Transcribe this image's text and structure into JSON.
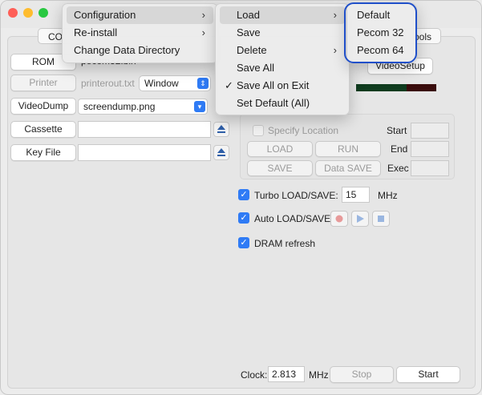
{
  "tabs": {
    "left": "CO",
    "right": "ools"
  },
  "rom": {
    "button": "ROM",
    "value": "pecom32.bin"
  },
  "printer": {
    "button": "Printer",
    "value": "printerout.txt",
    "select": "Window"
  },
  "videodump": {
    "button": "VideoDump",
    "value": "screendump.png"
  },
  "cassette": {
    "button": "Cassette",
    "value": ""
  },
  "keyfile": {
    "button": "Key File",
    "value": ""
  },
  "video_setup": "VideoSetup",
  "specify": {
    "label": "Specify Location",
    "load": "LOAD",
    "run": "RUN",
    "save": "SAVE",
    "data_save": "Data SAVE",
    "start": "Start",
    "end": "End",
    "exec": "Exec"
  },
  "options": {
    "turbo_label": "Turbo LOAD/SAVE:",
    "turbo_value": "15",
    "turbo_unit": "MHz",
    "auto_label": "Auto LOAD/SAVE",
    "dram_label": "DRAM refresh"
  },
  "footer": {
    "clock_label": "Clock:",
    "clock_value": "2.813",
    "clock_unit": "MHz",
    "stop": "Stop",
    "start": "Start"
  },
  "menu1": {
    "items": [
      "Configuration",
      "Re-install",
      "Change Data Directory"
    ]
  },
  "menu2": {
    "items": [
      "Load",
      "Save",
      "Delete",
      "Save All",
      "Save All on Exit",
      "Set Default (All)"
    ],
    "check": "✓"
  },
  "menu3": {
    "items": [
      "Default",
      "Pecom 32",
      "Pecom 64"
    ]
  },
  "colors": {
    "accent": "#2f7bf5",
    "highlight_ring": "#1f4fc9",
    "bar_green": "#0f3b1e",
    "bar_red": "#3a0c0c"
  }
}
